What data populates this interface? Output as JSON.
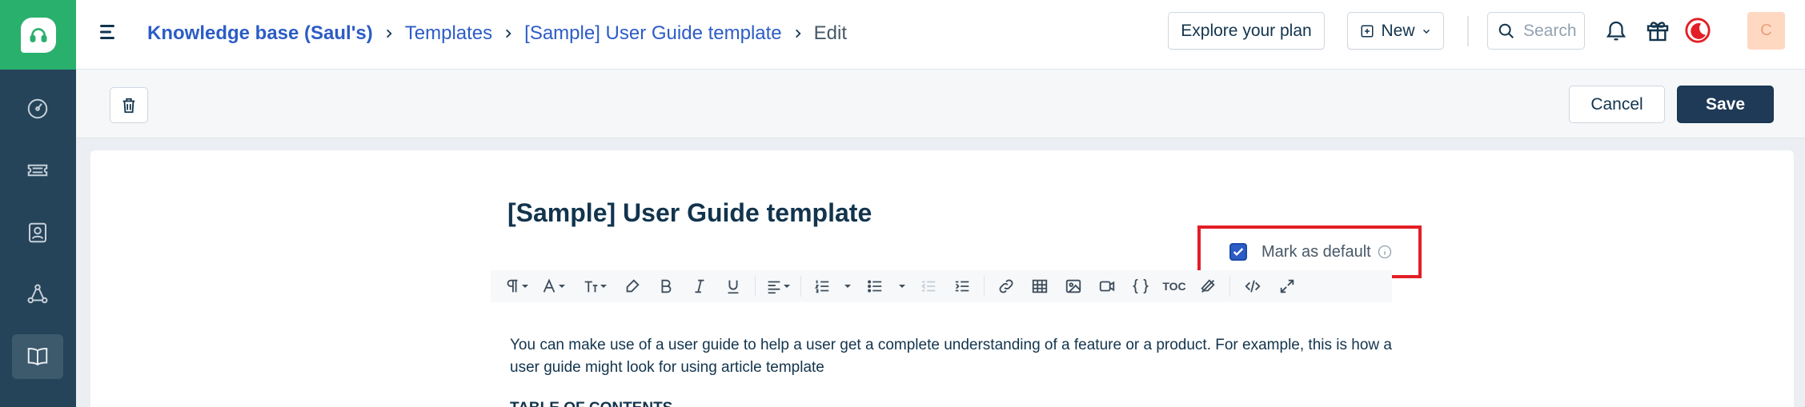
{
  "breadcrumb": {
    "items": [
      "Knowledge base (Saul's)",
      "Templates",
      "[Sample] User Guide template"
    ],
    "current": "Edit"
  },
  "header": {
    "explore_label": "Explore your plan",
    "new_label": "New",
    "search_placeholder": "Search",
    "avatar_initial": "C"
  },
  "actions": {
    "cancel_label": "Cancel",
    "save_label": "Save"
  },
  "article": {
    "title": "[Sample] User Guide template",
    "mark_default_label": "Mark as default",
    "mark_default_checked": true,
    "body": "You can make use of a user guide to help a user get a complete understanding of a feature or a product. For example, this is how a user guide might look for using article template",
    "toc_heading": "TABLE OF CONTENTS"
  },
  "toolbar": {
    "toc_label": "TOC"
  },
  "colors": {
    "sidebar": "#264459",
    "brand_green": "#2ab06d",
    "link": "#2c5cc5",
    "primary": "#1e3a57",
    "highlight": "#e31e26"
  }
}
